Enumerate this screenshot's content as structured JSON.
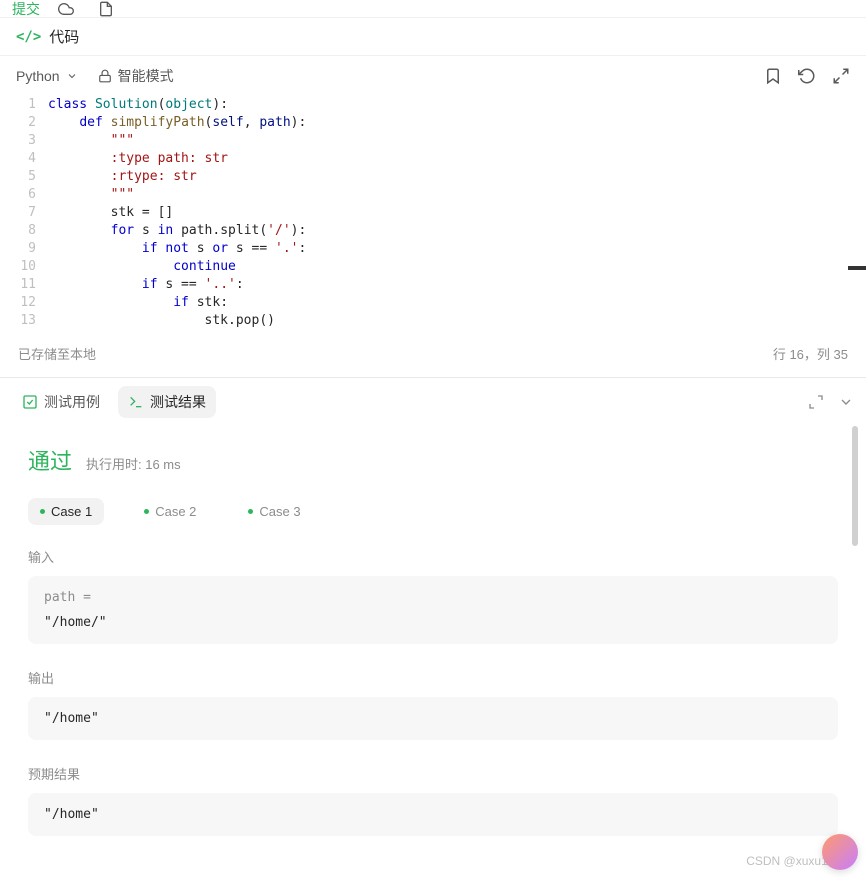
{
  "topBar": {
    "submit": "提交"
  },
  "header": {
    "title": "代码"
  },
  "toolbar": {
    "language": "Python",
    "mode": "智能模式"
  },
  "editorStatus": {
    "saved": "已存储至本地",
    "position": "行 16，列 35"
  },
  "code": {
    "lineNumbers": [
      "1",
      "2",
      "3",
      "4",
      "5",
      "6",
      "7",
      "8",
      "9",
      "10",
      "11",
      "12",
      "13"
    ],
    "lines": [
      [
        {
          "t": "class ",
          "c": "kw"
        },
        {
          "t": "Solution",
          "c": "cls"
        },
        {
          "t": "(",
          "c": ""
        },
        {
          "t": "object",
          "c": "cls"
        },
        {
          "t": "):",
          "c": ""
        }
      ],
      [
        {
          "t": "    ",
          "c": ""
        },
        {
          "t": "def ",
          "c": "kw"
        },
        {
          "t": "simplifyPath",
          "c": "fn"
        },
        {
          "t": "(",
          "c": ""
        },
        {
          "t": "self",
          "c": "prm"
        },
        {
          "t": ", ",
          "c": ""
        },
        {
          "t": "path",
          "c": "prm"
        },
        {
          "t": "):",
          "c": ""
        }
      ],
      [
        {
          "t": "        \"\"\"",
          "c": "cmt"
        }
      ],
      [
        {
          "t": "        :type path: str",
          "c": "cmt"
        }
      ],
      [
        {
          "t": "        :rtype: str",
          "c": "cmt"
        }
      ],
      [
        {
          "t": "        \"\"\"",
          "c": "cmt"
        }
      ],
      [
        {
          "t": "        stk = []",
          "c": ""
        }
      ],
      [
        {
          "t": "        ",
          "c": ""
        },
        {
          "t": "for ",
          "c": "kw"
        },
        {
          "t": "s ",
          "c": ""
        },
        {
          "t": "in ",
          "c": "kw"
        },
        {
          "t": "path.split(",
          "c": ""
        },
        {
          "t": "'/'",
          "c": "str"
        },
        {
          "t": "):",
          "c": ""
        }
      ],
      [
        {
          "t": "            ",
          "c": ""
        },
        {
          "t": "if not ",
          "c": "kw"
        },
        {
          "t": "s ",
          "c": ""
        },
        {
          "t": "or ",
          "c": "kw"
        },
        {
          "t": "s == ",
          "c": ""
        },
        {
          "t": "'.'",
          "c": "str"
        },
        {
          "t": ":",
          "c": ""
        }
      ],
      [
        {
          "t": "                ",
          "c": ""
        },
        {
          "t": "continue",
          "c": "kw"
        }
      ],
      [
        {
          "t": "            ",
          "c": ""
        },
        {
          "t": "if ",
          "c": "kw"
        },
        {
          "t": "s == ",
          "c": ""
        },
        {
          "t": "'..'",
          "c": "str"
        },
        {
          "t": ":",
          "c": ""
        }
      ],
      [
        {
          "t": "                ",
          "c": ""
        },
        {
          "t": "if ",
          "c": "kw"
        },
        {
          "t": "stk:",
          "c": ""
        }
      ],
      [
        {
          "t": "                    stk.pop()",
          "c": ""
        }
      ]
    ]
  },
  "tabs": {
    "testcase": "测试用例",
    "results": "测试结果"
  },
  "result": {
    "status": "通过",
    "runtimeLabel": "执行用时: 16 ms",
    "cases": [
      "Case 1",
      "Case 2",
      "Case 3"
    ],
    "sections": {
      "input": "输入",
      "output": "输出",
      "expected": "预期结果"
    },
    "inputLabel": "path =",
    "inputValue": "\"/home/\"",
    "outputValue": "\"/home\"",
    "expectedValue": "\"/home\""
  },
  "watermark": "CSDN @xuxu1116"
}
